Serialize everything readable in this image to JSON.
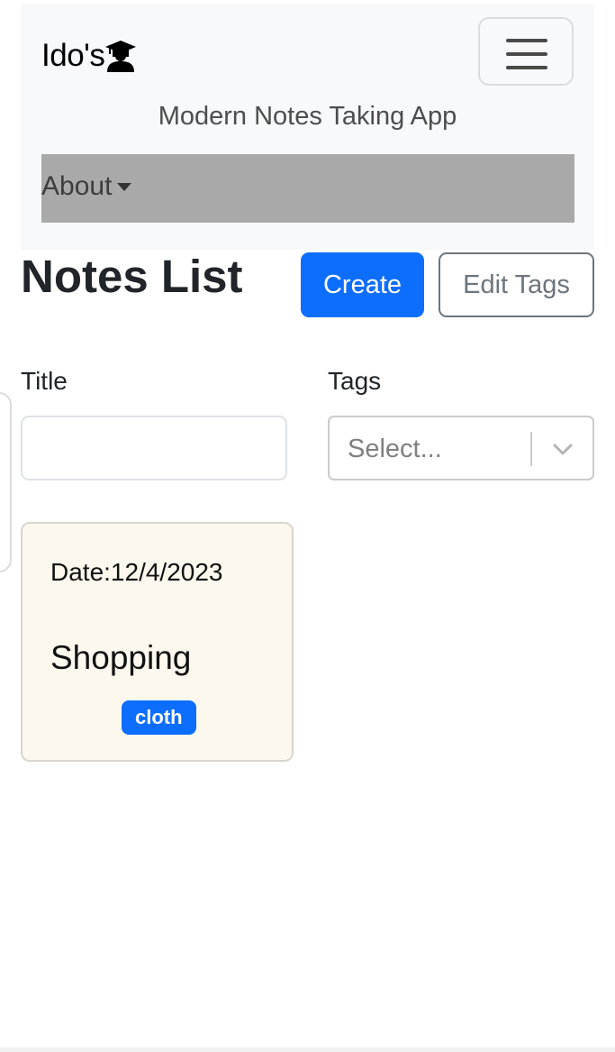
{
  "navbar": {
    "brand": "Ido's",
    "brand_icon": "teacher-icon",
    "subtitle": "Modern Notes Taking App",
    "about_label": "About"
  },
  "main": {
    "title": "Notes List",
    "create_label": "Create",
    "edit_tags_label": "Edit Tags"
  },
  "filters": {
    "title_label": "Title",
    "title_value": "",
    "tags_label": "Tags",
    "tags_placeholder": "Select..."
  },
  "notes": [
    {
      "date": "Date:12/4/2023",
      "title": "Shopping",
      "tags": [
        "cloth"
      ]
    }
  ],
  "colors": {
    "primary": "#0d6efd",
    "navbar_bg": "#f8f9fa",
    "about_bar_bg": "#a9a9a9",
    "card_bg": "#fcf8ee",
    "secondary": "#6c757d"
  }
}
